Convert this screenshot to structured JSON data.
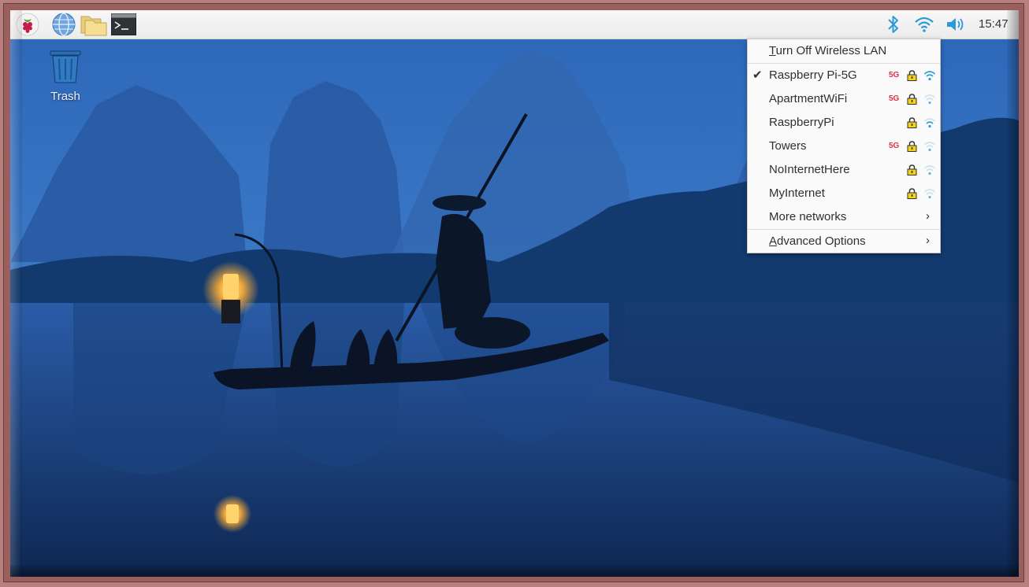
{
  "taskbar": {
    "clock": "15:47",
    "launchers": [
      "raspberry-menu",
      "web-browser",
      "file-manager",
      "terminal"
    ],
    "tray": [
      "bluetooth",
      "wireless",
      "volume"
    ]
  },
  "desktop": {
    "trash_label": "Trash"
  },
  "wifi_menu": {
    "turn_off": {
      "underline": "T",
      "rest": "urn Off Wireless LAN"
    },
    "networks": [
      {
        "name": "Raspberry Pi-5G",
        "connected": true,
        "band": "5G",
        "locked": true,
        "signal": "strong"
      },
      {
        "name": "ApartmentWiFi",
        "connected": false,
        "band": "5G",
        "locked": true,
        "signal": "weak"
      },
      {
        "name": "RaspberryPi",
        "connected": false,
        "band": "",
        "locked": true,
        "signal": "medium"
      },
      {
        "name": "Towers",
        "connected": false,
        "band": "5G",
        "locked": true,
        "signal": "weak"
      },
      {
        "name": "NoInternetHere",
        "connected": false,
        "band": "",
        "locked": true,
        "signal": "weak"
      },
      {
        "name": "MyInternet",
        "connected": false,
        "band": "",
        "locked": true,
        "signal": "weak"
      }
    ],
    "check_mark": "✔",
    "more_networks": "More networks",
    "advanced": {
      "underline": "A",
      "rest": "dvanced Options"
    },
    "submenu_arrow": "›"
  },
  "colors": {
    "accent_blue": "#2a9bd8",
    "tag_red": "#e0304a",
    "lock_yellow": "#f2d21b"
  }
}
